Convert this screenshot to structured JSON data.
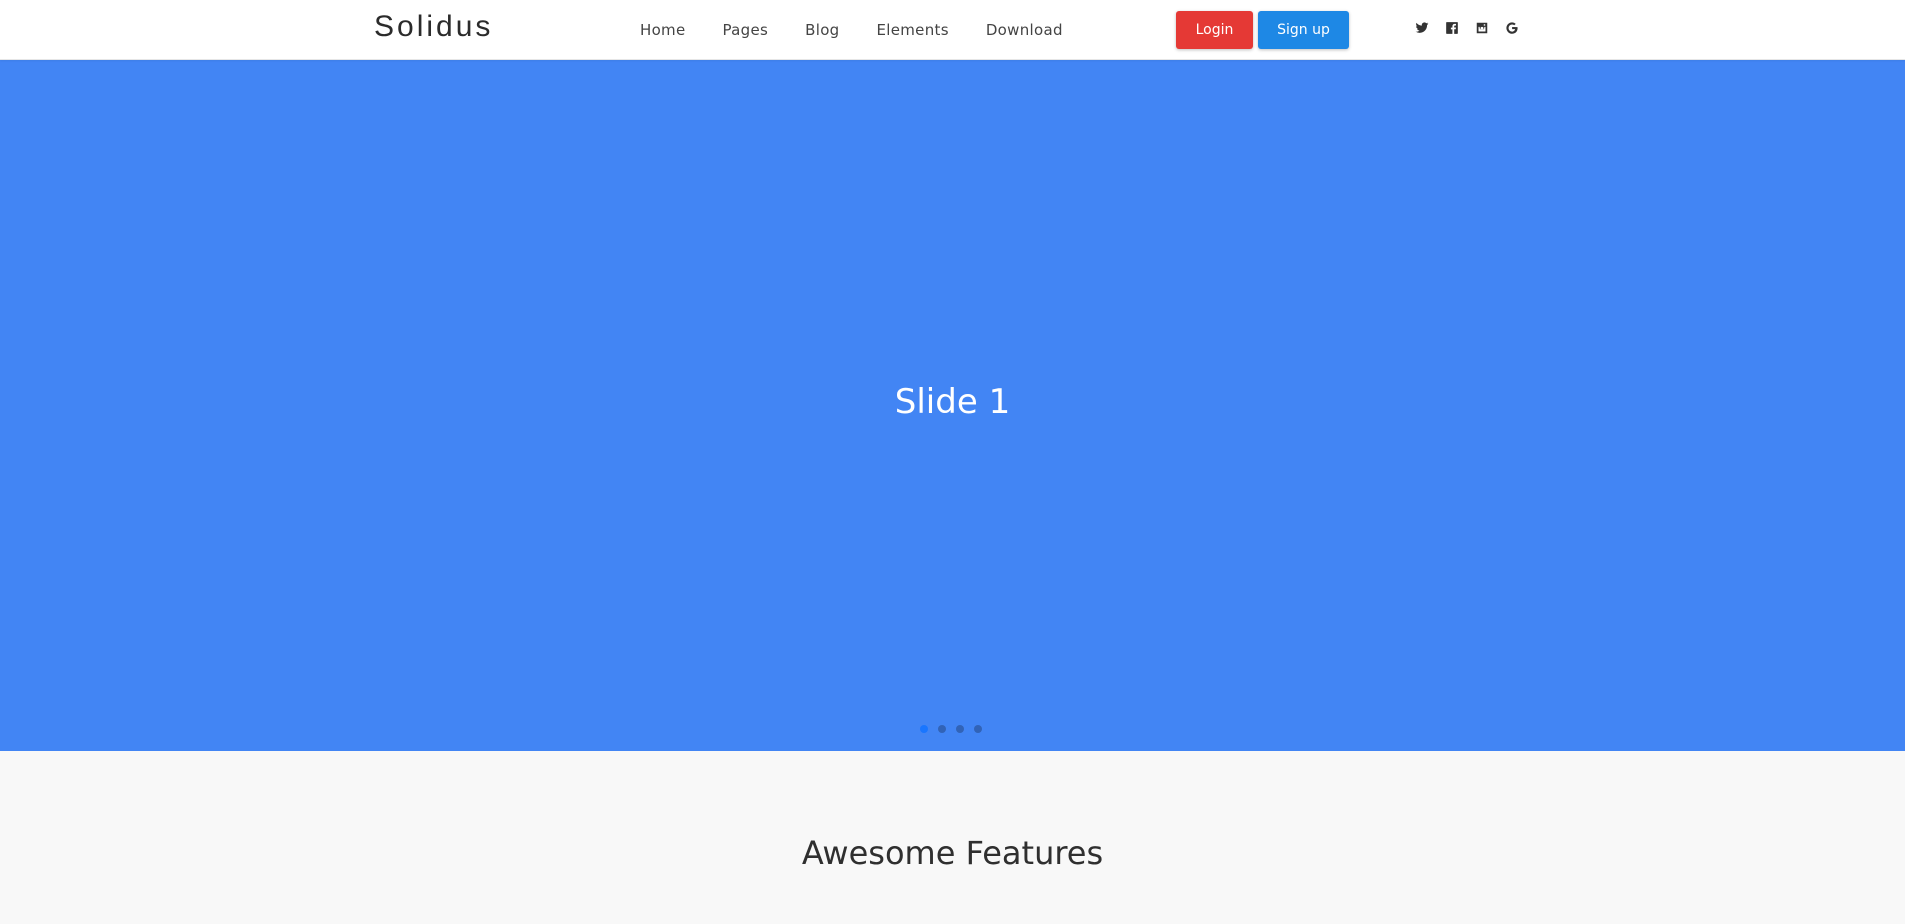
{
  "header": {
    "logo": "Solidus",
    "nav": [
      "Home",
      "Pages",
      "Blog",
      "Elements",
      "Download"
    ],
    "login_label": "Login",
    "signup_label": "Sign up",
    "social_icons": [
      "twitter-icon",
      "facebook-icon",
      "instagram-icon",
      "google-icon"
    ],
    "colors": {
      "login": "#e53935",
      "signup": "#1e88e5"
    }
  },
  "hero": {
    "slide_title": "Slide 1",
    "background": "#4285f4",
    "dots": {
      "count": 4,
      "active_index": 0
    }
  },
  "features": {
    "title": "Awesome Features"
  }
}
